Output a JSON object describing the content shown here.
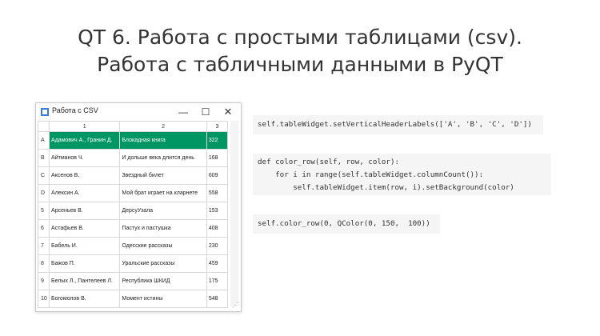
{
  "slide": {
    "title_line1": "QT 6. Работа с простыми таблицами (csv).",
    "title_line2": "Работа с табличными данными в PyQT"
  },
  "window": {
    "title": "Работа с CSV",
    "min_icon": "minimize-icon",
    "max_icon": "maximize-icon",
    "close_icon": "close-icon",
    "columns": [
      "1",
      "2",
      "3"
    ],
    "rows": [
      {
        "header": "A",
        "c1": "Адамович А., Гранин Д.",
        "c2": "Блокадная книга",
        "c3": "322",
        "highlight": true
      },
      {
        "header": "B",
        "c1": "Айтманов Ч.",
        "c2": "И дольше века длится день",
        "c3": "168"
      },
      {
        "header": "C",
        "c1": "Аксенов В.",
        "c2": "Звездный билет",
        "c3": "609"
      },
      {
        "header": "D",
        "c1": "Алексин А.",
        "c2": "Мой брат играет на кларнете",
        "c3": "558"
      },
      {
        "header": "5",
        "c1": "Арсеньев В.",
        "c2": "ДерсуУзала",
        "c3": "153"
      },
      {
        "header": "6",
        "c1": "Астафьев В.",
        "c2": "Пастух и пастушка",
        "c3": "408"
      },
      {
        "header": "7",
        "c1": "Бабель И.",
        "c2": "Одесские рассказы",
        "c3": "230"
      },
      {
        "header": "8",
        "c1": "Бажов П.",
        "c2": "Уральские рассказы",
        "c3": "459"
      },
      {
        "header": "9",
        "c1": "Белых Л., Пантелеев Л.",
        "c2": "Республика ШКИД",
        "c3": "175"
      },
      {
        "header": "10",
        "c1": "Богомолов В.",
        "c2": "Момент истины",
        "c3": "548"
      }
    ],
    "highlight_color": "#009664"
  },
  "code": {
    "block1": "self.tableWidget.setVerticalHeaderLabels(['A', 'B', 'C', 'D'])",
    "block2": [
      "def color_row(self, row, color):",
      "    for i in range(self.tableWidget.columnCount()):",
      "        self.tableWidget.item(row, i).setBackground(color)"
    ],
    "block3": "self.color_row(0, QColor(0, 150,  100))"
  }
}
